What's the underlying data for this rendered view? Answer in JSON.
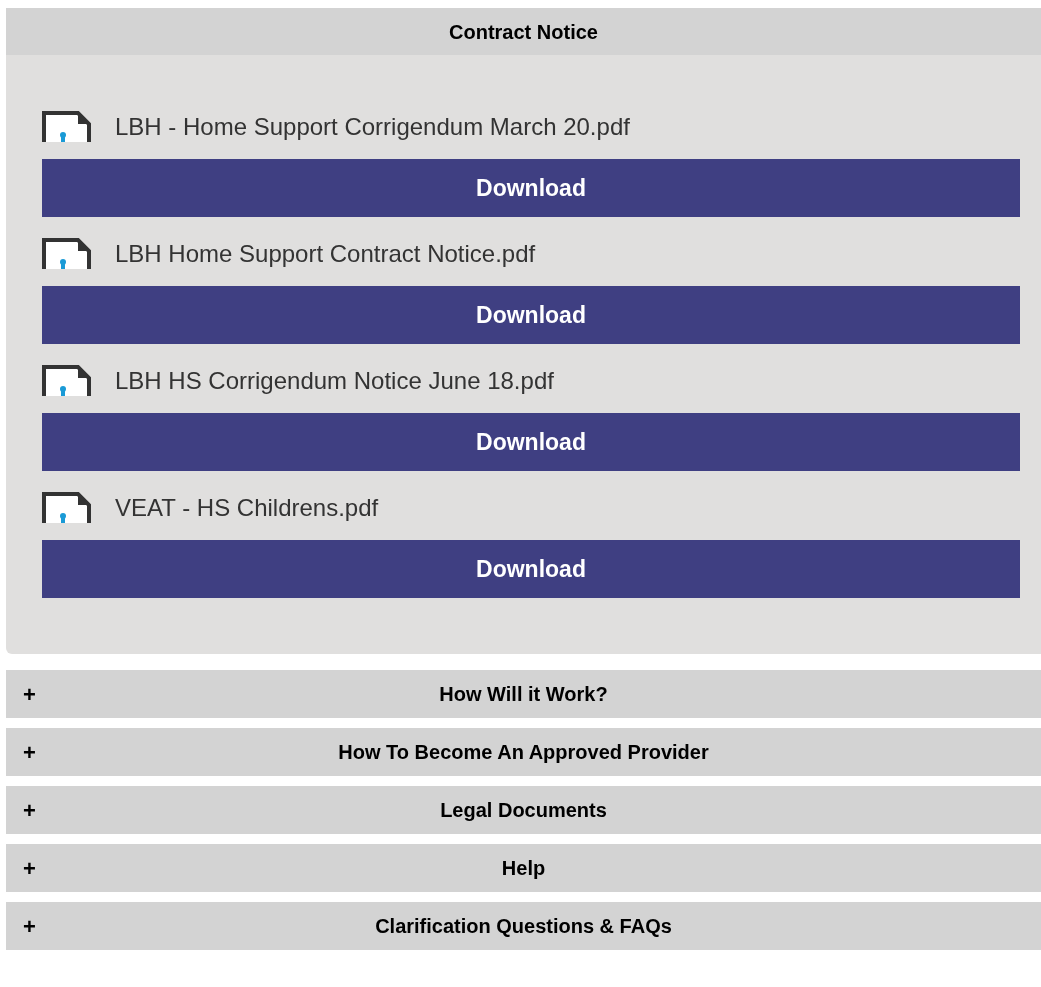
{
  "panel": {
    "title": "Contract Notice",
    "files": [
      {
        "name": "LBH - Home Support Corrigendum March 20.pdf",
        "button": "Download"
      },
      {
        "name": "LBH Home Support Contract Notice.pdf",
        "button": "Download"
      },
      {
        "name": "LBH HS Corrigendum Notice June 18.pdf",
        "button": "Download"
      },
      {
        "name": "VEAT - HS Childrens.pdf",
        "button": "Download"
      }
    ]
  },
  "sections": [
    {
      "toggle": "+",
      "title": "How Will it Work?"
    },
    {
      "toggle": "+",
      "title": "How To Become An Approved Provider"
    },
    {
      "toggle": "+",
      "title": "Legal Documents"
    },
    {
      "toggle": "+",
      "title": "Help"
    },
    {
      "toggle": "+",
      "title": "Clarification Questions & FAQs"
    }
  ]
}
